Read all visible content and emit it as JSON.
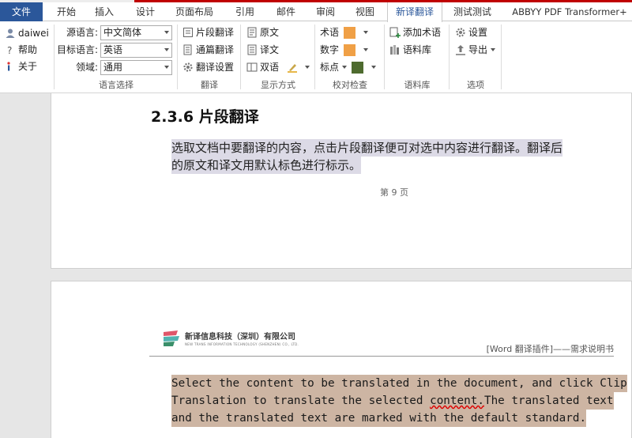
{
  "tabs": {
    "file": "文件",
    "home": "开始",
    "insert": "插入",
    "design": "设计",
    "layout": "页面布局",
    "references": "引用",
    "mailings": "邮件",
    "review": "审阅",
    "view": "视图",
    "translate": "新译翻译",
    "test": "测试测试",
    "abbyy": "ABBYY PDF Transformer+"
  },
  "user": {
    "name": "daiwei",
    "help": "帮助",
    "about": "关于"
  },
  "language": {
    "source_label": "源语言:",
    "source_value": "中文简体",
    "target_label": "目标语言:",
    "target_value": "英语",
    "domain_label": "领域:",
    "domain_value": "通用",
    "group_label": "语言选择"
  },
  "translate_group": {
    "clip": "片段翻译",
    "full": "通篇翻译",
    "settings": "翻译设置",
    "group_label": "翻译"
  },
  "display_group": {
    "original": "原文",
    "translation": "译文",
    "bilingual": "双语",
    "group_label": "显示方式"
  },
  "proofing_group": {
    "terms": "术语",
    "numbers": "数字",
    "punctuation": "标点",
    "group_label": "校对检查"
  },
  "corpus_group": {
    "add_term": "添加术语",
    "corpus": "语料库",
    "group_label": "语料库"
  },
  "options_group": {
    "settings": "设置",
    "export": "导出",
    "group_label": "选项"
  },
  "colors": {
    "accent": "#2b579a",
    "top_line": "#c00000",
    "term_swatch": "#f0a046",
    "number_swatch": "#f0a046",
    "punct_swatch": "#4e6b2f",
    "zh_highlight": "#dcdae6",
    "en_highlight": "#cdb5a3"
  },
  "document": {
    "heading": "2.3.6 片段翻译",
    "zh_lines": [
      "选取文档中要翻译的内容，点击片段翻译便可对选中内容进行翻译。翻译后",
      "的原文和译文用默认标色进行标示。"
    ],
    "page_number": "第 9 页",
    "company": "新译信息科技（深圳）有限公司",
    "company_en": "NEW TRANS INFORMATION TECHNOLOGY (SHENZHEN) CO., LTD.",
    "header_text": "[Word 翻译插件]——需求说明书",
    "en_lines": [
      "Select the content to be translated in the document, and click Clip",
      "Translation to translate the selected ",
      "and the translated text are marked with the default standard."
    ],
    "en_squiggle_word": "content.",
    "en_line2_tail": "The translated text"
  }
}
